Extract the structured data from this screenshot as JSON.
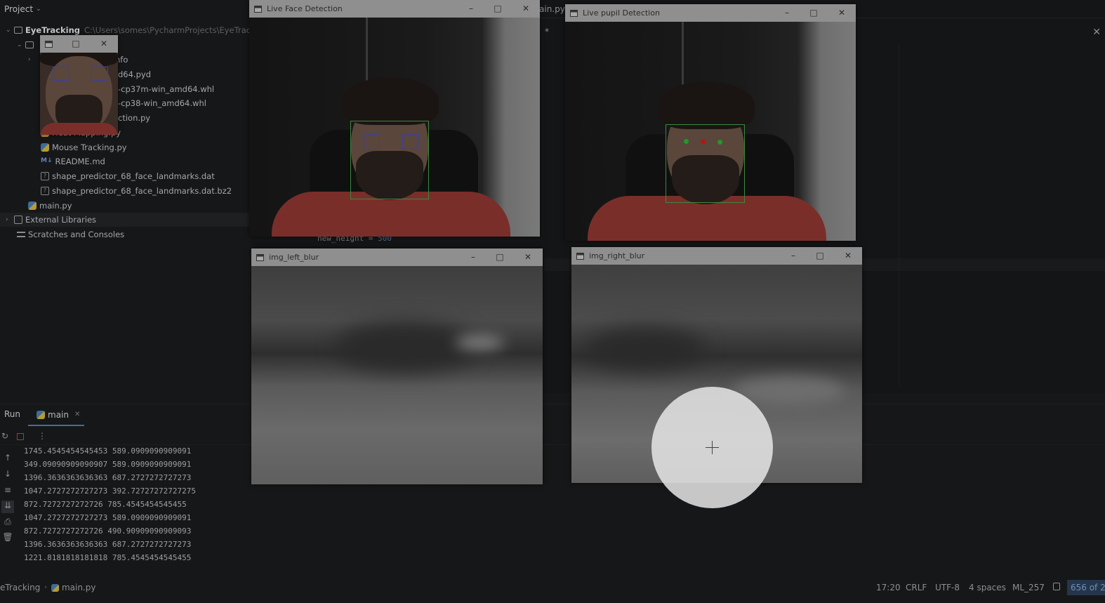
{
  "ide": {
    "project_header": "Project",
    "tree": [
      {
        "label": "EyeTracking",
        "path": "C:\\Users\\somes\\PycharmProjects\\EyeTracking",
        "kind": "root"
      },
      {
        "label": "",
        "kind": "folder"
      },
      {
        "label": "nfo",
        "kind": "partial"
      },
      {
        "label": "d64.pyd",
        "kind": "partial"
      },
      {
        "label": "-cp37m-win_amd64.whl",
        "kind": "partial"
      },
      {
        "label": "-cp38-win_amd64.whl",
        "kind": "partial"
      },
      {
        "label": "ction.py",
        "kind": "partial"
      },
      {
        "label": "Heat Mapping.py",
        "kind": "py"
      },
      {
        "label": "Mouse Tracking.py",
        "kind": "py"
      },
      {
        "label": "README.md",
        "kind": "md"
      },
      {
        "label": "shape_predictor_68_face_landmarks.dat",
        "kind": "dat"
      },
      {
        "label": "shape_predictor_68_face_landmarks.dat.bz2",
        "kind": "dat"
      },
      {
        "label": "main.py",
        "kind": "py"
      },
      {
        "label": "External Libraries",
        "kind": "lib"
      },
      {
        "label": "Scratches and Consoles",
        "kind": "scratch"
      }
    ],
    "editor": {
      "tab_partial_1": "ain.py",
      "tab_partial_2": "*",
      "code_line_var": "new_height = ",
      "code_line_num": "500"
    },
    "run": {
      "label": "Run",
      "tab": "main",
      "console": [
        "1745.4545454545453 589.0909090909091",
        "349.09090909090907 589.0909090909091",
        "1396.3636363636363 687.2727272727273",
        "1047.2727272727273 392.72727272727275",
        "872.7272727272726 785.4545454545455",
        "1047.2727272727273 589.0909090909091",
        "872.7272727272726 490.90909090909093",
        "1396.3636363636363 687.2727272727273",
        "1221.8181818181818 785.4545454545455"
      ]
    },
    "status": {
      "crumb_project": "eTracking",
      "crumb_file": "main.py",
      "position": "17:20",
      "line_sep": "CRLF",
      "encoding": "UTF-8",
      "indent": "4 spaces",
      "interpreter": "ML_257",
      "memory": "656 of 2"
    }
  },
  "windows": {
    "face": {
      "title": "Live Face Detection"
    },
    "pupil": {
      "title": "Live pupil Detection"
    },
    "left_blur": {
      "title": "img_left_blur"
    },
    "right_blur": {
      "title": "img_right_blur"
    },
    "small": {
      "title": ""
    }
  },
  "colors": {
    "face_box": "#3c8a3c",
    "eye_box": "#3b3f9a",
    "pupil_dot": "#1f9a2a",
    "center_dot": "#b01818"
  }
}
